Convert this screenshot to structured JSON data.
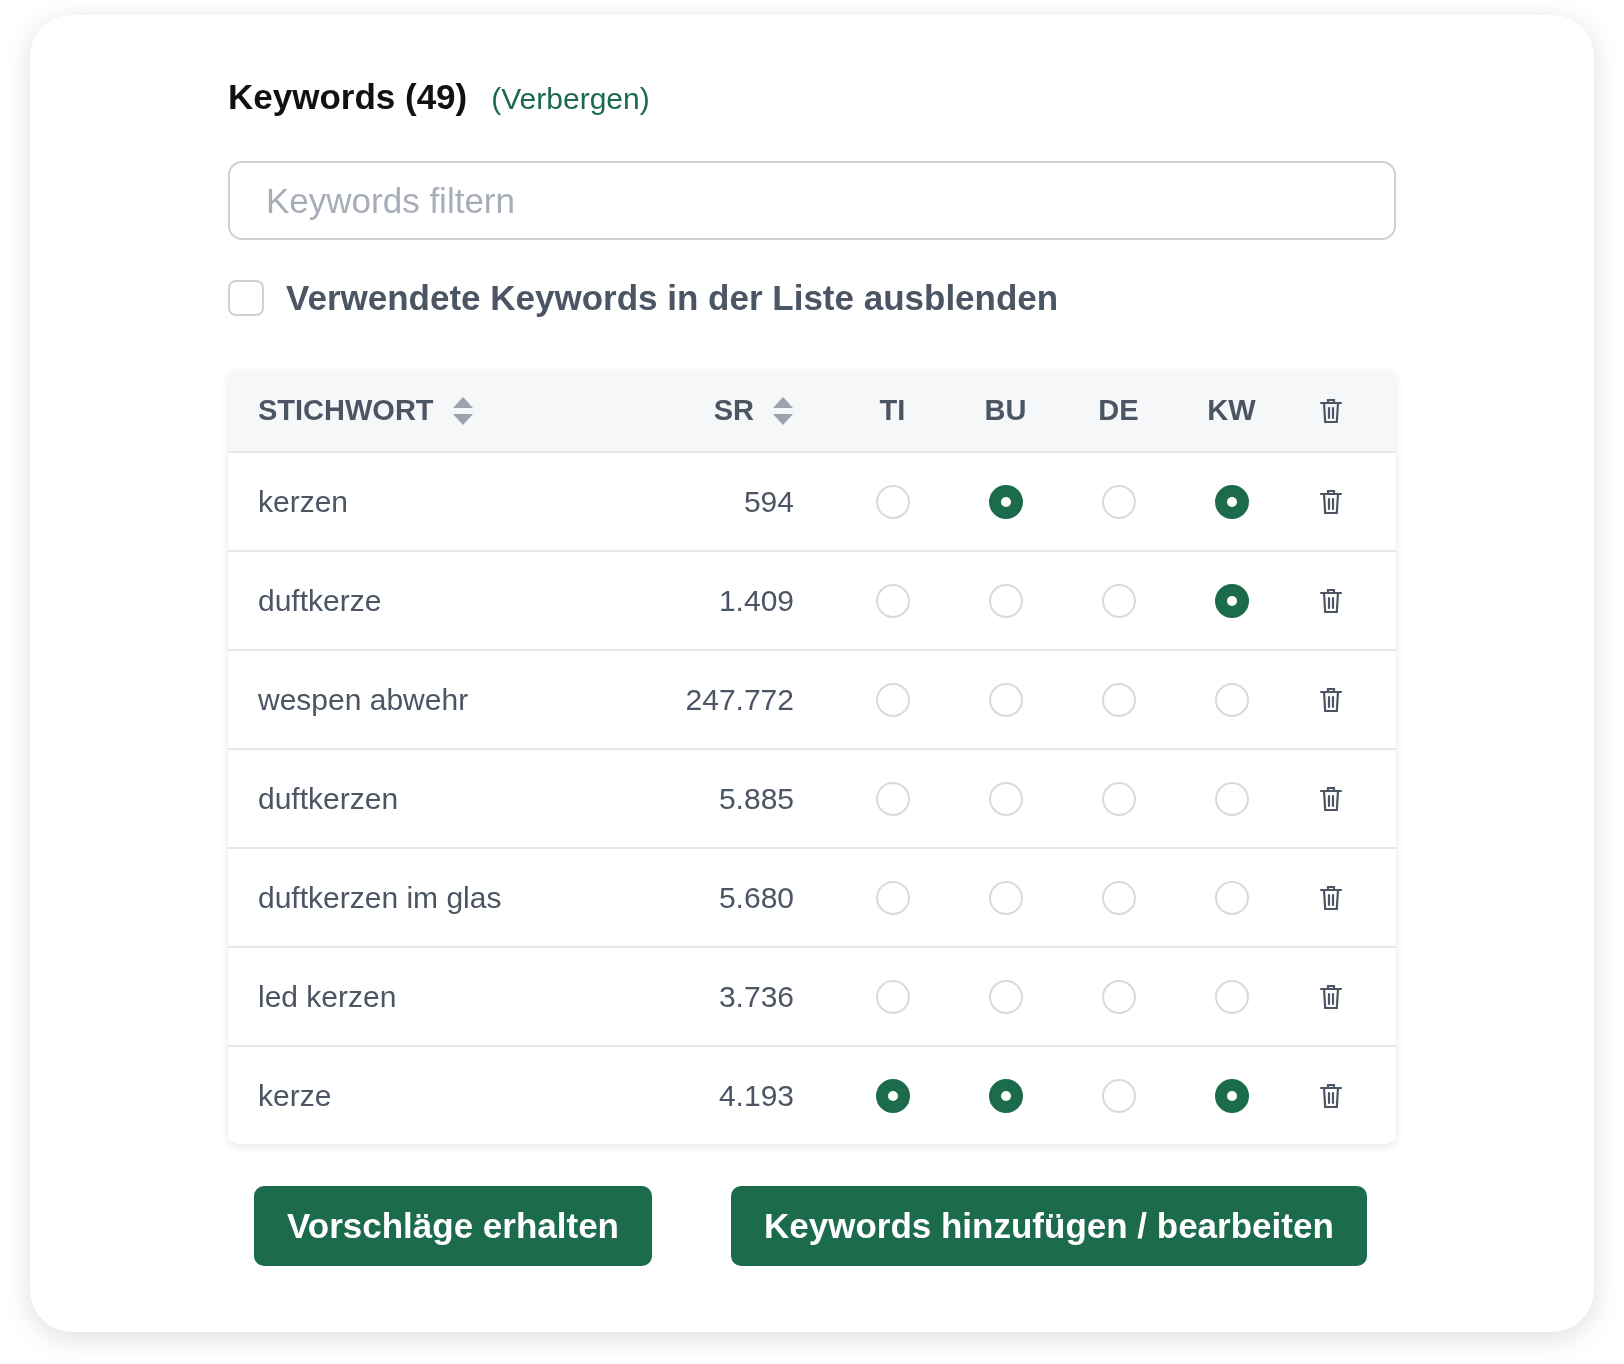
{
  "header": {
    "title": "Keywords (49)",
    "toggle_link": "(Verbergen)"
  },
  "filter": {
    "placeholder": "Keywords filtern"
  },
  "hide_used": {
    "label": "Verwendete Keywords in der Liste ausblenden",
    "checked": false
  },
  "table": {
    "columns": [
      {
        "label": "STICHWORT",
        "kind": "sortable"
      },
      {
        "label": "SR",
        "kind": "sortable"
      },
      {
        "label": "TI",
        "kind": "plain"
      },
      {
        "label": "BU",
        "kind": "plain"
      },
      {
        "label": "DE",
        "kind": "plain"
      },
      {
        "label": "KW",
        "kind": "plain"
      },
      {
        "kind": "delete"
      }
    ],
    "rows": [
      {
        "keyword": "kerzen",
        "sr": "594",
        "ti": false,
        "bu": true,
        "de": false,
        "kw": true
      },
      {
        "keyword": "duftkerze",
        "sr": "1.409",
        "ti": false,
        "bu": false,
        "de": false,
        "kw": true
      },
      {
        "keyword": "wespen abwehr",
        "sr": "247.772",
        "ti": false,
        "bu": false,
        "de": false,
        "kw": false
      },
      {
        "keyword": "duftkerzen",
        "sr": "5.885",
        "ti": false,
        "bu": false,
        "de": false,
        "kw": false
      },
      {
        "keyword": "duftkerzen im glas",
        "sr": "5.680",
        "ti": false,
        "bu": false,
        "de": false,
        "kw": false
      },
      {
        "keyword": "led kerzen",
        "sr": "3.736",
        "ti": false,
        "bu": false,
        "de": false,
        "kw": false
      },
      {
        "keyword": "kerze",
        "sr": "4.193",
        "ti": true,
        "bu": true,
        "de": false,
        "kw": true
      }
    ]
  },
  "buttons": [
    "Vorschläge erhalten",
    "Keywords hinzufügen / bearbeiten"
  ]
}
